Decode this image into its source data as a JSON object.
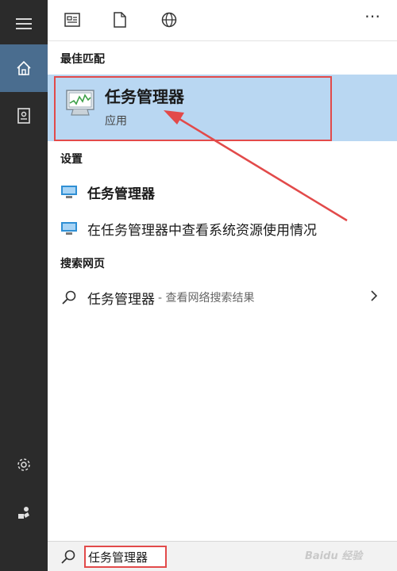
{
  "topbar": {
    "icons": [
      "apps-icon",
      "document-icon",
      "globe-icon"
    ],
    "more_label": "⋯"
  },
  "rail": {
    "items": [
      "menu-icon",
      "home-icon",
      "notebook-icon",
      "settings-icon",
      "feedback-icon"
    ],
    "active": "home-icon",
    "active_color": "#4a6d8f"
  },
  "results": {
    "best_match_header": "最佳匹配",
    "best_match": {
      "title": "任务管理器",
      "subtitle": "应用"
    },
    "settings_header": "设置",
    "settings_items": [
      {
        "label": "任务管理器"
      },
      {
        "label": "在任务管理器中查看系统资源使用情况"
      }
    ],
    "web_header": "搜索网页",
    "web_item": {
      "label": "任务管理器",
      "hint": "- 查看网络搜索结果"
    }
  },
  "search": {
    "value": "任务管理器"
  },
  "colors": {
    "highlight": "#b9d7f2",
    "annotation": "#e24a4a",
    "rail": "#2b2b2b"
  }
}
